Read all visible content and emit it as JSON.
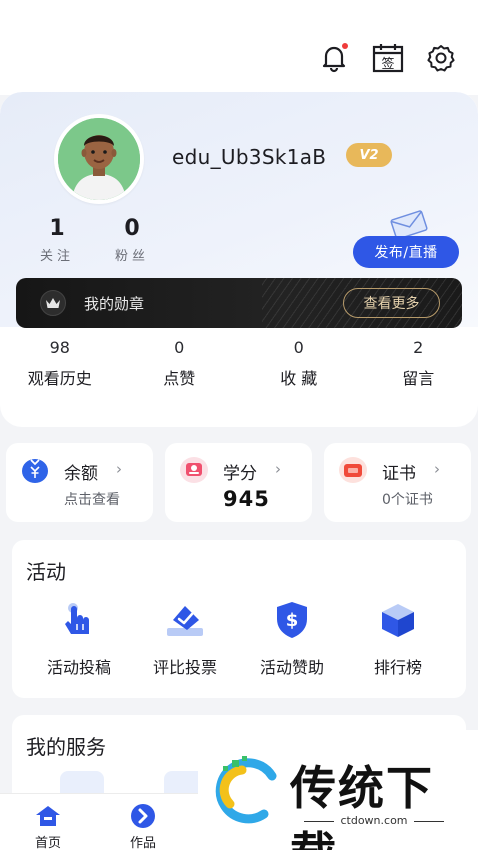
{
  "header": {
    "icons": [
      "bell-icon",
      "sign-in-icon",
      "settings-icon"
    ],
    "sign_char": "签"
  },
  "profile": {
    "username": "edu_Ub3Sk1aB",
    "level": "V2",
    "following_count": "1",
    "following_label": "关注",
    "fans_count": "0",
    "fans_label": "粉丝",
    "publish_label": "发布/直播"
  },
  "medals": {
    "label": "我的勋章",
    "more_label": "查看更多"
  },
  "stats": [
    {
      "num": "98",
      "label": "观看历史"
    },
    {
      "num": "0",
      "label": "点赞"
    },
    {
      "num": "0",
      "label": "收 藏"
    },
    {
      "num": "2",
      "label": "留言"
    }
  ],
  "wallet": [
    {
      "title": "余额",
      "sub": "点击查看",
      "icon": "wallet-yen-icon",
      "color": "#2f64e8"
    },
    {
      "title": "学分",
      "value": "945",
      "icon": "credit-icon",
      "color": "#f0506e"
    },
    {
      "title": "证书",
      "sub": "0个证书",
      "icon": "certificate-icon",
      "color": "#f04a3a"
    }
  ],
  "activity": {
    "title": "活动",
    "items": [
      {
        "label": "活动投稿",
        "icon": "hand-pointer-icon"
      },
      {
        "label": "评比投票",
        "icon": "vote-check-icon"
      },
      {
        "label": "活动赞助",
        "icon": "dollar-shield-icon"
      },
      {
        "label": "排行榜",
        "icon": "cube-icon"
      }
    ]
  },
  "services": {
    "title": "我的服务"
  },
  "bottom_nav": [
    {
      "label": "首页",
      "icon": "home-icon"
    },
    {
      "label": "作品",
      "icon": "works-arrow-icon"
    }
  ],
  "watermark": {
    "name": "传统下载",
    "url": "ctdown.com"
  },
  "colors": {
    "accent": "#2f57e6",
    "badge": "#e8b85a",
    "medal_bar": "#1a1a1a"
  }
}
